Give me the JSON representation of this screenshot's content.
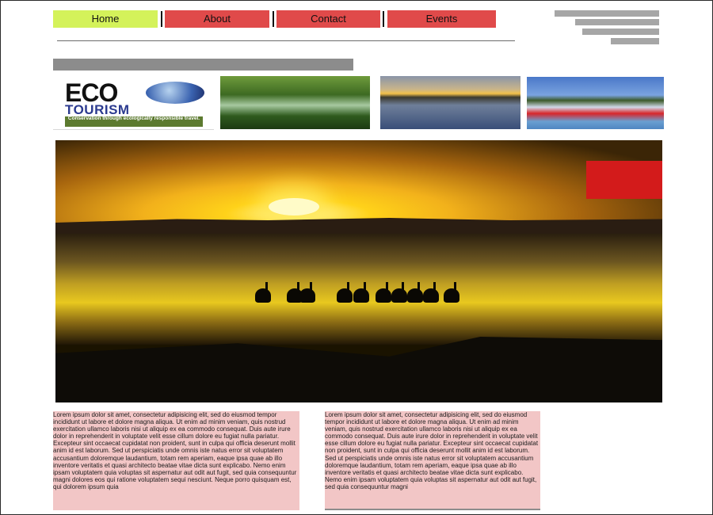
{
  "nav": {
    "items": [
      {
        "label": "Home",
        "color": "#d4f25a"
      },
      {
        "label": "About",
        "color": "#e04a4a"
      },
      {
        "label": "Contact",
        "color": "#e04a4a"
      },
      {
        "label": "Events",
        "color": "#e04a4a"
      }
    ]
  },
  "icons": {
    "menu": "hamburger-lines-icon"
  },
  "logo": {
    "eco_word": "ECO",
    "tourism_word": "TOURISM",
    "tagline": "Conservation through ecologically responsible travel."
  },
  "colors": {
    "active_nav": "#d4f25a",
    "nav": "#e04a4a",
    "text_panel": "#f2c6c6",
    "hero_badge": "#d31b1b"
  },
  "content": {
    "left_paragraph": "Lorem ipsum dolor sit amet, consectetur adipisicing elit, sed do eiusmod tempor incididunt ut labore et dolore magna aliqua. Ut enim ad minim veniam, quis nostrud exercitation ullamco laboris nisi ut aliquip ex ea commodo consequat. Duis aute irure dolor in reprehenderit in voluptate velit esse cillum dolore eu fugiat nulla pariatur. Excepteur sint occaecat cupidatat non proident, sunt in culpa qui officia deserunt mollit anim id est laborum. Sed ut perspiciatis unde omnis iste natus error sit voluptatem accusantium doloremque laudantium, totam rem aperiam, eaque ipsa quae ab illo inventore veritatis et quasi architecto beatae vitae dicta sunt explicabo. Nemo enim ipsam voluptatem quia voluptas sit aspernatur aut odit aut fugit, sed quia consequuntur magni dolores eos qui ratione voluptatem sequi nesciunt. Neque porro quisquam est, qui dolorem ipsum quia",
    "right_paragraph": "Lorem ipsum dolor sit amet, consectetur adipisicing elit, sed do eiusmod tempor incididunt ut labore et dolore magna aliqua. Ut enim ad minim veniam, quis nostrud exercitation ullamco laboris nisi ut aliquip ex ea commodo consequat. Duis aute irure dolor in reprehenderit in voluptate velit esse cillum dolore eu fugiat nulla pariatur. Excepteur sint occaecat cupidatat non proident, sunt in culpa qui officia deserunt mollit anim id est laborum. Sed ut perspiciatis unde omnis iste natus error sit voluptatem accusantium doloremque laudantium, totam rem aperiam, eaque ipsa quae ab illo inventore veritatis et quasi architecto beatae vitae dicta sunt explicabo. Nemo enim ipsam voluptatem quia voluptas sit aspernatur aut odit aut fugit, sed quia consequuntur magni"
  }
}
